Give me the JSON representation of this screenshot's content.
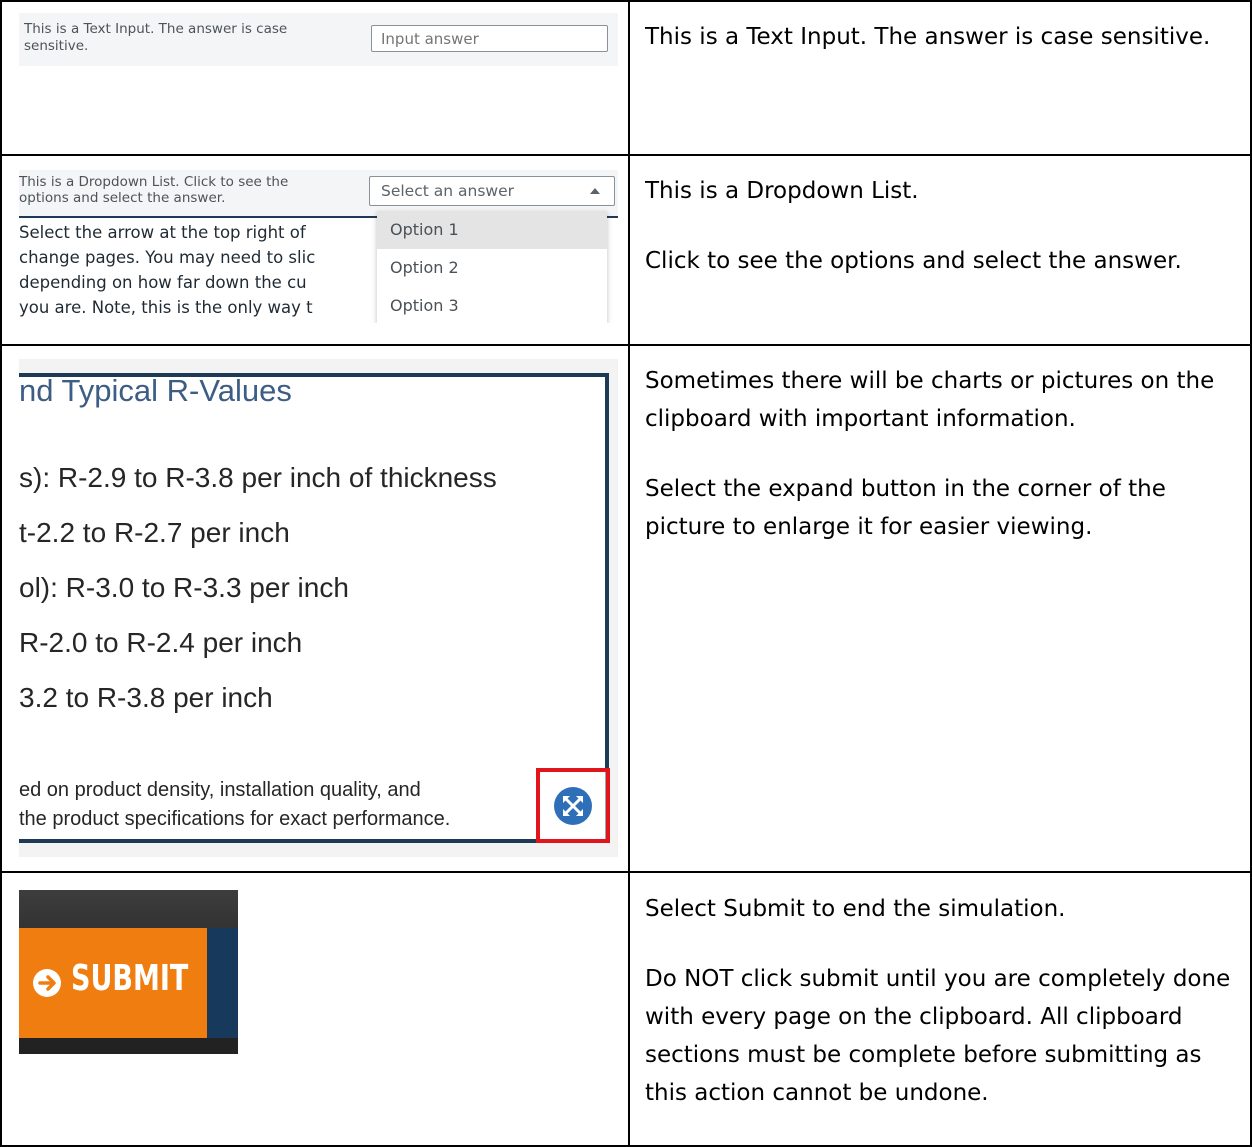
{
  "rows": [
    {
      "description_paragraphs": [
        "This is a Text Input. The answer is case sensitive."
      ],
      "example": {
        "question": "This is a Text Input. The answer is case sensitive.",
        "input_placeholder": "Input answer"
      }
    },
    {
      "description_paragraphs": [
        "This is a Dropdown List.",
        "Click to see the options and select the answer."
      ],
      "example": {
        "question_line1": "This is a Dropdown List. Click to see the",
        "question_line2": "options and select the answer.",
        "select_value": "Select an answer",
        "options": [
          "Option 1",
          "Option 2",
          "Option 3"
        ],
        "body_lines": [
          "Select the arrow at the top right of",
          "change pages. You may need to slic",
          "depending on how far down the cu",
          "you are. Note, this is the only way t"
        ]
      }
    },
    {
      "description_paragraphs": [
        "Sometimes there will be charts or pictures on the clipboard with important information.",
        "Select the expand button in the corner of the picture to enlarge it for easier viewing."
      ],
      "example": {
        "title": "nd Typical R-Values",
        "lines": [
          "s): R-2.9 to R-3.8 per inch of thickness",
          "t-2.2 to R-2.7 per inch",
          "ol): R-3.0 to R-3.3 per inch",
          "R-2.0 to R-2.4 per inch",
          "3.2 to R-3.8 per inch"
        ],
        "footer_lines": [
          "ed on product density, installation quality, and",
          "the product specifications for exact performance."
        ],
        "expand_icon": "expand-icon"
      }
    },
    {
      "description_paragraphs": [
        "Select Submit to end the simulation.",
        "Do NOT click submit until you are completely done with every page on the clipboard. All clipboard sections must be complete before submitting as this action cannot be undone."
      ],
      "example": {
        "submit_label": "SUBMIT",
        "submit_icon": "arrow-right-circle-icon"
      }
    }
  ],
  "colors": {
    "grid": "#000000",
    "panel_bg": "#f3f5f6",
    "frame_blue": "#1d3a57",
    "title_blue": "#3d5d84",
    "highlight_red": "#e0161c",
    "expand_blue": "#2f6fb8",
    "submit_orange": "#f07d10",
    "submit_navy": "#173a5c"
  }
}
